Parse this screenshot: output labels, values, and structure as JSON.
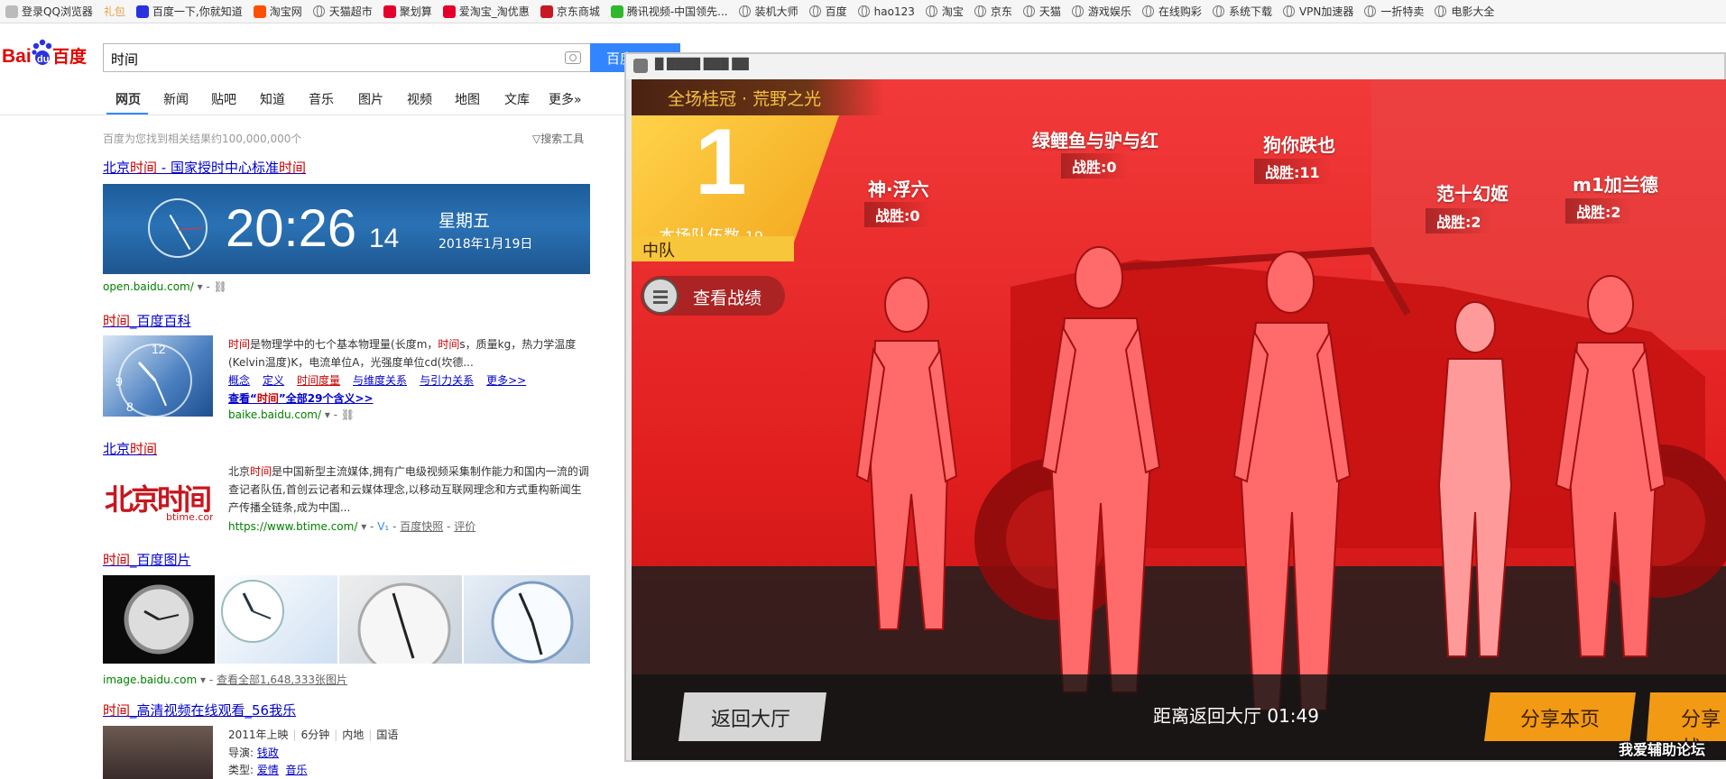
{
  "bookmarks": [
    {
      "label": "登录QQ浏览器",
      "icon": "user-icon"
    },
    {
      "label": "礼包",
      "icon": "gift-icon"
    },
    {
      "label": "百度一下,你就知道",
      "icon": "baidu-paw-icon"
    },
    {
      "label": "淘宝网",
      "icon": "taobao-icon"
    },
    {
      "label": "天猫超市",
      "icon": "globe-icon"
    },
    {
      "label": "聚划算",
      "icon": "juhuasuan-icon"
    },
    {
      "label": "爱淘宝_淘优惠",
      "icon": "aitaobao-icon"
    },
    {
      "label": "京东商城",
      "icon": "jd-icon"
    },
    {
      "label": "腾讯视频-中国领先...",
      "icon": "tencent-video-icon"
    },
    {
      "label": "装机大师",
      "icon": "globe-icon"
    },
    {
      "label": "百度",
      "icon": "globe-icon"
    },
    {
      "label": "hao123",
      "icon": "globe-icon"
    },
    {
      "label": "淘宝",
      "icon": "globe-icon"
    },
    {
      "label": "京东",
      "icon": "globe-icon"
    },
    {
      "label": "天猫",
      "icon": "globe-icon"
    },
    {
      "label": "游戏娱乐",
      "icon": "globe-icon"
    },
    {
      "label": "在线购彩",
      "icon": "globe-icon"
    },
    {
      "label": "系统下载",
      "icon": "globe-icon"
    },
    {
      "label": "VPN加速器",
      "icon": "globe-icon"
    },
    {
      "label": "一折特卖",
      "icon": "globe-icon"
    },
    {
      "label": "电影大全",
      "icon": "globe-icon"
    }
  ],
  "search": {
    "logo_text_left": "Bai",
    "logo_text_mid": "du",
    "logo_text_right": "百度",
    "query": "时间",
    "button": "百度"
  },
  "tabs": [
    "网页",
    "新闻",
    "贴吧",
    "知道",
    "音乐",
    "图片",
    "视频",
    "地图",
    "文库",
    "更多»"
  ],
  "meta": {
    "result_count": "百度为您找到相关结果约100,000,000个",
    "tools": "搜索工具"
  },
  "results": {
    "r1": {
      "title_a": "北京",
      "title_em": "时间",
      "title_b": " - 国家授时中心标准",
      "title_em2": "时间",
      "time": "20:26",
      "seconds": "14",
      "weekday": "星期五",
      "date": "2018年1月19日",
      "url": "open.baidu.com/"
    },
    "r2": {
      "title_em": "时间",
      "title_b": "_百度百科",
      "snippet_em": "时间",
      "snippet_1": "是物理学中的七个基本物理量(长度m，",
      "snippet_em2": "时间",
      "snippet_2": "s，质量kg，热力学温度(Kelvin温度)K，电流单位A，光强度单位cd(坎德...",
      "links": [
        "概念",
        "定义",
        "时间度量",
        "与维度关系",
        "与引力关系",
        "更多>>"
      ],
      "more_a": "查看“",
      "more_em": "时间",
      "more_b": "”全部29个含义>>",
      "url": "baike.baidu.com/"
    },
    "r3": {
      "title_a": "北京",
      "title_em": "时间",
      "logo_a": "北京",
      "logo_b": "时间",
      "logo_sub": "btime.com",
      "snippet_a": "北京",
      "snippet_em": "时间",
      "snippet_1": "是中国新型主流媒体,拥有广电级视频采集制作能力和国内一流的调查记者队伍,首创云记者和云媒体理念,以移动互联网理念和方式重构新闻生产传播全链条,成为中国...",
      "url": "https://www.btime.com/",
      "cache": "百度快照",
      "review": "评价"
    },
    "r4": {
      "title_em": "时间",
      "title_b": "_百度图片",
      "url": "image.baidu.com",
      "more": "查看全部1,648,333张图片"
    },
    "r5": {
      "title_em": "时间",
      "title_b": "_高清视频在线观看_56我乐",
      "info": [
        "2011年上映",
        "6分钟",
        "内地",
        "国语"
      ],
      "director_label": "导演:",
      "director": "钱政",
      "type_label": "类型:",
      "types": [
        "爱情",
        "音乐"
      ]
    }
  },
  "game": {
    "window_title": "█ ████ ███ ██",
    "mode": "全场桂冠 · 荒野之光",
    "rank": "1",
    "team_count_label": "本场队伍数",
    "team_count": "19",
    "squad": "中队",
    "stats_button": "查看战绩",
    "players": [
      {
        "name": "神·浮六",
        "wins": "战胜:0"
      },
      {
        "name": "绿鲤鱼与驴与红",
        "wins": "战胜:0"
      },
      {
        "name": "狗你跌也",
        "wins": "战胜:11"
      },
      {
        "name": "范十幻姬",
        "wins": "战胜:2"
      },
      {
        "name": "m1加兰德",
        "wins": "战胜:2"
      }
    ],
    "back_button": "返回大厅",
    "countdown": "距离返回大厅   01:49",
    "share_button": "分享本页",
    "share_button2": "分享战",
    "watermark": "我爱辅助论坛"
  },
  "colors": {
    "baidu_blue": "#3385ff",
    "link_blue": "#0000cc",
    "em_red": "#cc0000",
    "game_red": "#e31b1b",
    "banner_gold": "#f5c042",
    "share_orange": "#f29a14"
  }
}
